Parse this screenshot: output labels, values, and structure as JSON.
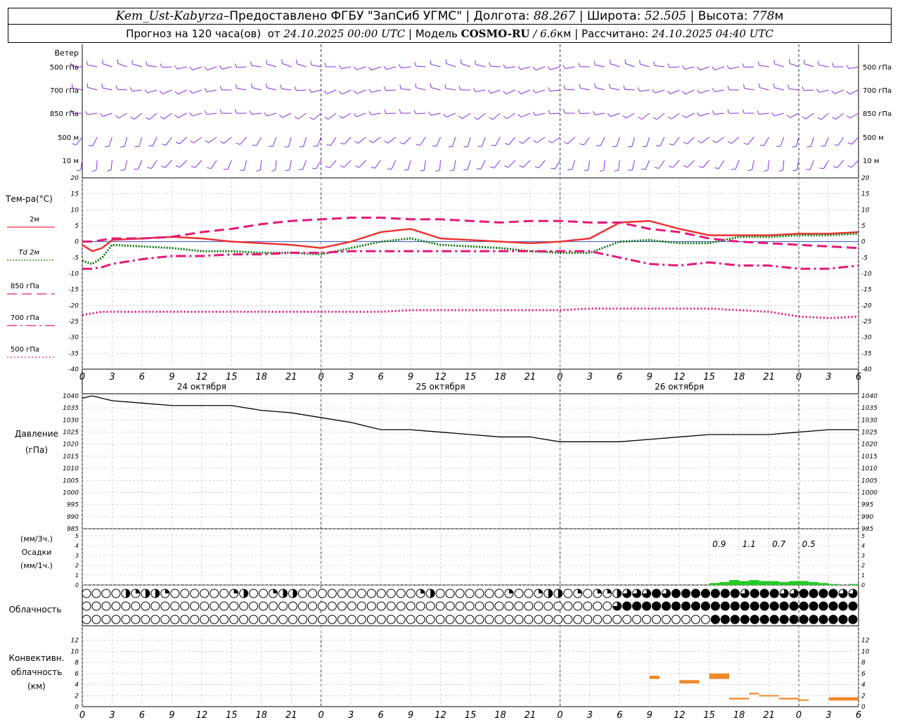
{
  "header": {
    "station": "Kem_Ust-Kabyrza",
    "dash": " – ",
    "provided": "Предоставлено ФГБУ \"ЗапСиб УГМС\"",
    "lon_label": "Долгота:",
    "lon_value": "88.267",
    "lat_label": "Широта:",
    "lat_value": "52.505",
    "alt_label": "Высота:",
    "alt_value": "778",
    "alt_unit": "м",
    "fc_label": "Прогноз на 120 часа(ов)  от",
    "fc_start": "24.10.2025 00:00 UTC",
    "model_label": "Модель",
    "model_name": "COSMO-RU",
    "model_res": "/ 6.6",
    "model_res_unit": "км",
    "calc_label": "Рассчитано:",
    "calc_time": "24.10.2025 04:40 UTC",
    "sep": " | "
  },
  "colors": {
    "wind": "#8a2be2",
    "t2m": "#ee3333",
    "td2m": "#117711",
    "t850": "#e5187a",
    "t700": "#e5187a",
    "t500": "#e5187a",
    "pressure": "#000000",
    "precip": "#22cc22",
    "convective": "#f08a2a"
  },
  "chart_data": [
    {
      "type": "wind_barbs",
      "panel_label": "Ветер",
      "levels": [
        "500 гПа",
        "700 гПа",
        "850 гПа",
        "500 м",
        "10  м"
      ],
      "level_directions_deg": [
        270,
        265,
        250,
        215,
        205
      ]
    },
    {
      "type": "line",
      "panel_label": "Тем-ра(°C)",
      "ylim": [
        -40,
        20
      ],
      "yticks": [
        20,
        15,
        10,
        5,
        0,
        -5,
        -10,
        -15,
        -20,
        -25,
        -30,
        -35,
        -40
      ],
      "x_hours": [
        0,
        1,
        2,
        3,
        6,
        9,
        12,
        15,
        18,
        21,
        24,
        27,
        30,
        33,
        36,
        39,
        42,
        45,
        48,
        51,
        54,
        57,
        60,
        63,
        66,
        69,
        72,
        75,
        78
      ],
      "series": [
        {
          "name": "2м",
          "key": "t2m",
          "values": [
            -1,
            -3,
            -2,
            0.5,
            1,
            1.5,
            1,
            0,
            -0.5,
            -1,
            -2,
            0,
            3,
            4,
            1,
            0.5,
            0,
            -0.5,
            0,
            1,
            6,
            6.5,
            4,
            2,
            2,
            2,
            2.5,
            2.5,
            3
          ]
        },
        {
          "name": "Td  2м",
          "key": "td2m",
          "values": [
            -6,
            -7,
            -5,
            -1,
            -1.5,
            -2,
            -3,
            -3,
            -3.5,
            -3.5,
            -4,
            -2,
            0,
            1,
            -1,
            -1.5,
            -2,
            -3,
            -3.5,
            -3.5,
            0,
            0.5,
            -0.5,
            -0.5,
            1.5,
            1.5,
            2,
            2,
            2.5
          ]
        },
        {
          "name": "850 гПа",
          "key": "t850",
          "values": [
            0,
            0,
            0.5,
            1,
            1,
            1.5,
            3,
            4,
            5.5,
            6.5,
            7,
            7.5,
            7.5,
            7,
            7,
            6.5,
            6,
            6.5,
            6.5,
            6,
            6,
            4,
            3,
            1,
            0,
            -0.5,
            -1,
            -1.5,
            -2
          ]
        },
        {
          "name": "700 гПа",
          "key": "t700",
          "values": [
            -8.5,
            -8.5,
            -8,
            -7,
            -5.5,
            -4.5,
            -4.5,
            -4,
            -4,
            -3.5,
            -3.5,
            -3,
            -3,
            -3,
            -3,
            -3,
            -3,
            -3,
            -3,
            -3,
            -5,
            -7,
            -7.5,
            -6.5,
            -7.5,
            -7.5,
            -8.5,
            -8.5,
            -7.5
          ]
        },
        {
          "name": "500 гПа",
          "key": "t500",
          "values": [
            -23,
            -22.5,
            -22,
            -22,
            -22,
            -22,
            -22,
            -22,
            -22,
            -22,
            -22,
            -22,
            -22,
            -21.5,
            -21.5,
            -21.5,
            -21.5,
            -21.5,
            -21.5,
            -21,
            -21,
            -21,
            -21,
            -21,
            -21.5,
            -22,
            -23.5,
            -24,
            -23.5
          ]
        }
      ]
    },
    {
      "type": "line",
      "panel_label_1": "Давление",
      "panel_label_2": "(гПа)",
      "ylim": [
        985,
        1040
      ],
      "yticks": [
        1040,
        1035,
        1030,
        1025,
        1020,
        1015,
        1010,
        1005,
        1000,
        995,
        990,
        985
      ],
      "x_hours": [
        0,
        1,
        3,
        6,
        9,
        12,
        15,
        18,
        21,
        24,
        27,
        30,
        33,
        36,
        39,
        42,
        45,
        48,
        51,
        54,
        57,
        60,
        63,
        66,
        69,
        72,
        75,
        78
      ],
      "series": [
        {
          "name": "pressure",
          "key": "pressure",
          "values": [
            1039,
            1040,
            1038,
            1037,
            1036,
            1036,
            1036,
            1034,
            1033,
            1031,
            1029,
            1026,
            1026,
            1025,
            1024,
            1023,
            1023,
            1021,
            1021,
            1021,
            1022,
            1023,
            1024,
            1024,
            1024,
            1025,
            1026,
            1026
          ]
        }
      ]
    },
    {
      "type": "bar",
      "panel_label_1": "(мм/3ч.)",
      "panel_label_2": "Осадки",
      "panel_label_3": "(мм/1ч.)",
      "ylim": [
        0,
        5
      ],
      "yticks": [
        5,
        4,
        3,
        2,
        1,
        0
      ],
      "x_hours": [
        63,
        64,
        65,
        66,
        67,
        68,
        69,
        70,
        71,
        72,
        73,
        74,
        75,
        77
      ],
      "values_1h": [
        0.2,
        0.3,
        0.5,
        0.4,
        0.5,
        0.4,
        0.4,
        0.3,
        0.4,
        0.4,
        0.3,
        0.2,
        0.1,
        0.1
      ],
      "totals_3h": [
        {
          "x_hour": 64,
          "label": "0.9"
        },
        {
          "x_hour": 67,
          "label": "1.1"
        },
        {
          "x_hour": 70,
          "label": "0.7"
        },
        {
          "x_hour": 73,
          "label": "0.5"
        }
      ]
    },
    {
      "type": "table",
      "panel_label": "Облачность",
      "hours_per_symbol": 1,
      "rows": [
        [
          0,
          0,
          0,
          0,
          2,
          1,
          2,
          2,
          1,
          0,
          0,
          0,
          0,
          0,
          0,
          0,
          0,
          0,
          0,
          0,
          0,
          0,
          0,
          0,
          0,
          0,
          0,
          0,
          0,
          0,
          0,
          0,
          0,
          0,
          0,
          0,
          0,
          0,
          0,
          0,
          0,
          0,
          0,
          0,
          0,
          0,
          0,
          0,
          0,
          0,
          0,
          0,
          0,
          0,
          0,
          0,
          0,
          0,
          0,
          0,
          0,
          0,
          0,
          0,
          0,
          0,
          0,
          0,
          0,
          0,
          0,
          0,
          0,
          0,
          0,
          0,
          0,
          0,
          0
        ],
        [
          0,
          0,
          0,
          0,
          0,
          0,
          0,
          0,
          0,
          0,
          0,
          0,
          0,
          0,
          0,
          0,
          0,
          0,
          0,
          0,
          0,
          0,
          0,
          0,
          0,
          0,
          0,
          0,
          0,
          0,
          0,
          0,
          0,
          0,
          0,
          0,
          0,
          0,
          0,
          0,
          0,
          0,
          0,
          0,
          0,
          0,
          0,
          0,
          0,
          0,
          0,
          0,
          0,
          0,
          0,
          0,
          0,
          0,
          0,
          0,
          0,
          0,
          0,
          0,
          0,
          0,
          0,
          0,
          0,
          0,
          0,
          0,
          0,
          0,
          0,
          0,
          0,
          0,
          0
        ],
        [
          0,
          0,
          0,
          0,
          0,
          0,
          0,
          0,
          0,
          0,
          0,
          0,
          0,
          0,
          0,
          0,
          0,
          0,
          0,
          0,
          0,
          0,
          0,
          0,
          0,
          0,
          0,
          0,
          0,
          0,
          0,
          0,
          0,
          0,
          0,
          0,
          0,
          0,
          0,
          0,
          0,
          0,
          0,
          0,
          0,
          0,
          0,
          0,
          0,
          0,
          0,
          0,
          0,
          0,
          0,
          0,
          0,
          0,
          0,
          0,
          0,
          0,
          0,
          0,
          0,
          0,
          0,
          0,
          0,
          0,
          0,
          0,
          0,
          0,
          0,
          0,
          0,
          0,
          0
        ]
      ],
      "patch": [
        {
          "row": 0,
          "from": 15,
          "to": 21,
          "pattern": [
            1,
            2,
            0,
            0,
            1,
            2,
            2
          ]
        },
        {
          "row": 0,
          "from": 34,
          "to": 36,
          "pattern": [
            1,
            2,
            0
          ]
        },
        {
          "row": 0,
          "from": 42,
          "to": 78,
          "pattern": [
            0,
            1,
            0,
            0,
            1,
            2,
            2,
            0,
            1,
            0,
            1,
            1,
            2,
            3,
            3,
            3,
            4,
            3,
            4,
            4,
            4,
            4,
            4,
            4,
            4,
            3,
            4,
            4,
            4,
            3,
            3,
            4,
            4,
            4,
            4,
            3,
            3,
            1,
            1,
            1,
            1,
            0,
            0,
            0,
            0,
            0,
            0,
            0,
            0,
            0
          ]
        },
        {
          "row": 1,
          "from": 54,
          "to": 78,
          "pattern": [
            3,
            4,
            4,
            4,
            4,
            4,
            4,
            4,
            4,
            4,
            4,
            4,
            4,
            4,
            4,
            4,
            4,
            4,
            4,
            4,
            4,
            4,
            4,
            4,
            4,
            3,
            1,
            0
          ]
        },
        {
          "row": 2,
          "from": 64,
          "to": 78,
          "pattern": [
            4,
            4,
            4,
            4,
            4,
            4,
            4,
            4,
            4,
            4,
            4,
            4,
            4,
            4,
            4
          ]
        }
      ]
    },
    {
      "type": "bar",
      "panel_label_1": "Конвективн.",
      "panel_label_2": "облачность",
      "panel_label_3": "(км)",
      "ylim": [
        0,
        14
      ],
      "yticks": [
        12,
        10,
        8,
        6,
        4,
        2,
        0
      ],
      "segments_km": [
        {
          "from_hour": 57,
          "to_hour": 58,
          "base": 5.0,
          "top": 5.6
        },
        {
          "from_hour": 60,
          "to_hour": 62,
          "base": 4.2,
          "top": 4.8
        },
        {
          "from_hour": 63,
          "to_hour": 65,
          "base": 5.0,
          "top": 6.0
        },
        {
          "from_hour": 65,
          "to_hour": 67,
          "base": 1.3,
          "top": 1.6
        },
        {
          "from_hour": 67,
          "to_hour": 68,
          "base": 2.2,
          "top": 2.5
        },
        {
          "from_hour": 68,
          "to_hour": 70,
          "base": 1.9,
          "top": 2.1
        },
        {
          "from_hour": 70,
          "to_hour": 72,
          "base": 1.3,
          "top": 1.6
        },
        {
          "from_hour": 72,
          "to_hour": 73,
          "base": 1.1,
          "top": 1.3
        },
        {
          "from_hour": 75,
          "to_hour": 78,
          "base": 1.1,
          "top": 1.7
        }
      ]
    }
  ],
  "x_axis": {
    "hour_step_ticks": [
      0,
      3,
      6,
      9,
      12,
      15,
      18,
      21,
      0,
      3,
      6,
      9,
      12,
      15,
      18,
      21,
      0,
      3,
      6,
      9,
      12,
      15,
      18,
      21,
      0,
      3,
      6
    ],
    "day_labels": [
      "24 октября",
      "25 октября",
      "26 октября"
    ],
    "range_hours": [
      0,
      78
    ]
  }
}
